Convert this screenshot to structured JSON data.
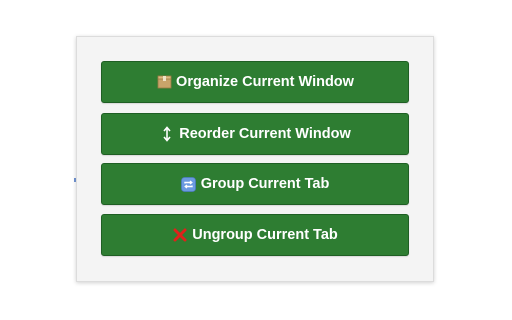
{
  "popup": {
    "buttons": [
      {
        "label": "Organize Current Window",
        "icon": "box-icon"
      },
      {
        "label": "Reorder Current Window",
        "icon": "up-down-arrow-icon"
      },
      {
        "label": "Group Current Tab",
        "icon": "repeat-icon"
      },
      {
        "label": "Ungroup Current Tab",
        "icon": "cross-mark-icon"
      }
    ]
  },
  "colors": {
    "button_bg": "#2e7d32",
    "button_text": "#ffffff",
    "popup_bg": "#f4f4f4"
  }
}
